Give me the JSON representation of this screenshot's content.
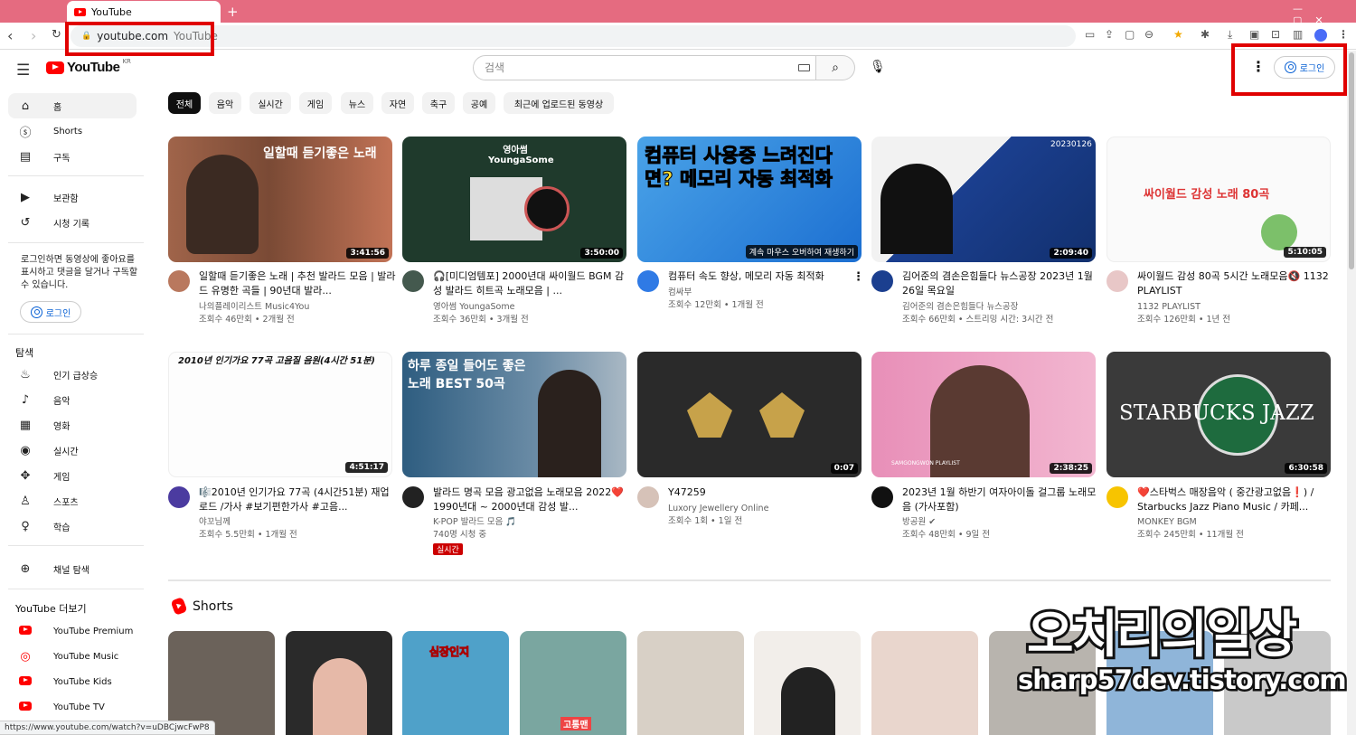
{
  "browser": {
    "tab_title": "YouTube",
    "url_host": "youtube.com",
    "url_title": "YouTube",
    "status_url": "https://www.youtube.com/watch?v=uDBCjwcFwP8"
  },
  "header": {
    "logo_text": "YouTube",
    "logo_region": "KR",
    "search_placeholder": "검색",
    "login_label": "로그인"
  },
  "sidebar": {
    "main": [
      {
        "label": "홈",
        "icon": "home-icon"
      },
      {
        "label": "Shorts",
        "icon": "shorts-icon"
      },
      {
        "label": "구독",
        "icon": "subscriptions-icon"
      }
    ],
    "library": [
      {
        "label": "보관함",
        "icon": "library-icon"
      },
      {
        "label": "시청 기록",
        "icon": "history-icon"
      }
    ],
    "signin_note": "로그인하면 동영상에 좋아요를 표시하고 댓글을 달거나 구독할 수 있습니다.",
    "signin_button": "로그인",
    "explore_title": "탐색",
    "explore": [
      {
        "label": "인기 급상승",
        "icon": "trending-icon"
      },
      {
        "label": "음악",
        "icon": "music-icon"
      },
      {
        "label": "영화",
        "icon": "movie-icon"
      },
      {
        "label": "실시간",
        "icon": "live-icon"
      },
      {
        "label": "게임",
        "icon": "gaming-icon"
      },
      {
        "label": "스포츠",
        "icon": "sports-icon"
      },
      {
        "label": "학습",
        "icon": "learning-icon"
      }
    ],
    "browse_channels": "채널 탐색",
    "more_title": "YouTube 더보기",
    "more": [
      {
        "label": "YouTube Premium"
      },
      {
        "label": "YouTube Music"
      },
      {
        "label": "YouTube Kids"
      },
      {
        "label": "YouTube TV"
      }
    ]
  },
  "chips": [
    "전체",
    "음악",
    "실시간",
    "게임",
    "뉴스",
    "자연",
    "축구",
    "공예",
    "최근에 업로드된 동영상"
  ],
  "videos": [
    {
      "title": "일할때 듣기좋은 노래 | 추천 발라드 모음 | 발라드 유명한 곡들 | 90년대 발라...",
      "channel": "나의플레이리스트 Music4You",
      "meta": "조회수 46만회 • 2개월 전",
      "duration": "3:41:56",
      "thumb_text": "일할때 듣기좋은 노래"
    },
    {
      "title": "🎧[미디엄템포] 2000년대 싸이월드 BGM 감성 발라드 히트곡 노래모음 | ...",
      "channel": "영아썸 YoungaSome",
      "meta": "조회수 36만회 • 3개월 전",
      "duration": "3:50:00",
      "thumb_text": "영아썸 YoungaSome"
    },
    {
      "title": "컴퓨터 속도 향상, 메모리 자동 최적화",
      "channel": "컴싸부",
      "meta": "조회수 12만회 • 1개월 전",
      "duration": "",
      "thumb_text": "컴퓨터 사용중 느려진다면? 메모리 자동 최적화",
      "hover_text": "계속 마우스 오버하여 재생하기"
    },
    {
      "title": "김어준의 겸손은힘들다 뉴스공장 2023년 1월 26일 목요일",
      "channel": "김어준의 겸손은힘들다 뉴스공장",
      "meta": "조회수 66만회 • 스트리밍 시간: 3시간 전",
      "duration": "2:09:40",
      "thumb_text": "20230126"
    },
    {
      "title": "싸이월드 감성 80곡 5시간 노래모음🔇 1132 PLAYLIST",
      "channel": "1132 PLAYLIST",
      "meta": "조회수 126만회 • 1년 전",
      "duration": "5:10:05",
      "thumb_text": "싸이월드 감성 노래 80곡"
    },
    {
      "title": "🎼2010년 인기가요 77곡 (4시간51분) 재업로드 /가사 #보기편한가사 #고음...",
      "channel": "야꼬님께",
      "meta": "조회수 5.5만회 • 1개월 전",
      "duration": "4:51:17",
      "thumb_text": "2010년 인기가요 77곡 고음질 음원(4시간 51분)"
    },
    {
      "title": "발라드 명곡 모음 광고없음 노래모음 2022❤️1990년대 ~ 2000년대 감성 발...",
      "channel": "K-POP 발라드 모음 🎵",
      "meta": "740명 시청 중",
      "duration": "",
      "live": "실시간",
      "thumb_text": "하루 종일 들어도 좋은노래 BEST 50곡"
    },
    {
      "title": "Y47259",
      "channel": "Luxory Jewellery Online",
      "meta": "조회수 1회 • 1일 전",
      "duration": "0:07",
      "thumb_text": ""
    },
    {
      "title": "2023년 1월 하반기 여자아이돌 걸그룹 노래모음 (가사포함)",
      "channel": "방공원 ✔",
      "meta": "조회수 48만회 • 9일 전",
      "duration": "2:38:25",
      "thumb_text": "SAMGONGWON PLAYLIST"
    },
    {
      "title": "❤️스타벅스 매장음악 ( 중간광고없음❗) / Starbucks Jazz Piano Music / 카페...",
      "channel": "MONKEY BGM",
      "meta": "조회수 245만회 • 11개월 전",
      "duration": "6:30:58",
      "thumb_text": "STARBUCKS JAZZ"
    }
  ],
  "shorts": {
    "title": "Shorts",
    "items": [
      "",
      "",
      "심장인지",
      "고통맨",
      "",
      "",
      "",
      "",
      "",
      ""
    ]
  },
  "watermark": {
    "line1": "오치리의일상",
    "line2": "sharp57dev.tistory.com"
  },
  "colors": {
    "accent_red": "#ff0000",
    "link_blue": "#065fd4",
    "highlight_box": "#e00000",
    "tab_strip": "#e56b80"
  }
}
